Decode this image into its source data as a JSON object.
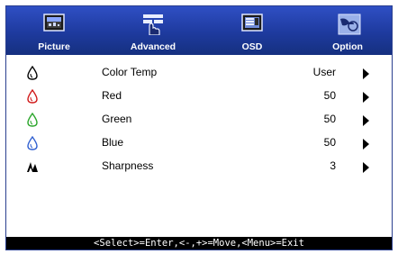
{
  "tabs": [
    {
      "id": "picture",
      "label": "Picture",
      "icon": "picture-monitor-icon"
    },
    {
      "id": "advanced",
      "label": "Advanced",
      "icon": "advanced-settings-icon",
      "active": true
    },
    {
      "id": "osd",
      "label": "OSD",
      "icon": "osd-monitor-icon"
    },
    {
      "id": "option",
      "label": "Option",
      "icon": "option-hand-icon"
    }
  ],
  "rows": [
    {
      "label": "Color Temp",
      "value": "User",
      "icon": "color-drop-icon",
      "color": "#000000"
    },
    {
      "label": "Red",
      "value": "50",
      "icon": "red-drop-icon",
      "color": "#d01818"
    },
    {
      "label": "Green",
      "value": "50",
      "icon": "green-drop-icon",
      "color": "#2aa52a"
    },
    {
      "label": "Blue",
      "value": "50",
      "icon": "blue-drop-icon",
      "color": "#2f5fd0"
    },
    {
      "label": "Sharpness",
      "value": "3",
      "icon": "sharpness-icon",
      "color": "#000000"
    }
  ],
  "status": "<Select>=Enter,<-,+>=Move,<Menu>=Exit",
  "colors": {
    "tabbar": "#1e3a9e",
    "border": "#2a3f8f",
    "status_bg": "#000000"
  }
}
